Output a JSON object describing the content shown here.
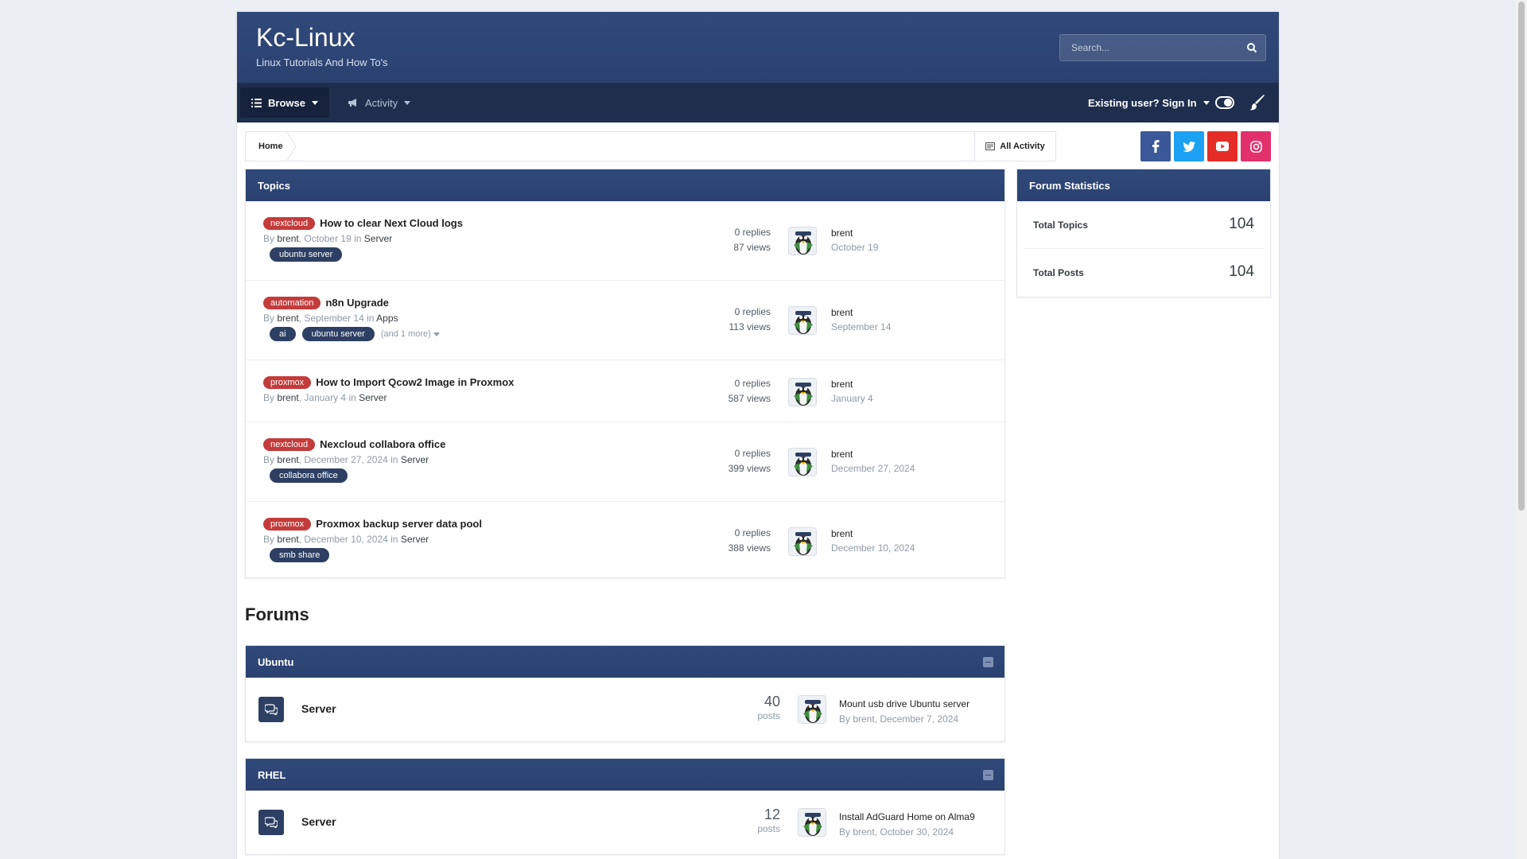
{
  "site": {
    "title": "Kc-Linux",
    "tagline": "Linux Tutorials And How To's",
    "search_placeholder": "Search..."
  },
  "nav": {
    "browse": "Browse",
    "activity": "Activity",
    "signin": "Existing user? Sign In"
  },
  "breadcrumb": {
    "home": "Home",
    "all_activity": "All Activity"
  },
  "social": [
    "facebook-icon",
    "twitter-icon",
    "youtube-icon",
    "instagram-icon"
  ],
  "topics": {
    "heading": "Topics",
    "items": [
      {
        "prefix": "nextcloud",
        "title": "How to clear Next Cloud logs",
        "by": "By",
        "author": "brent",
        "date": "October 19",
        "in": "in",
        "forum": "Server",
        "tags": [
          "ubuntu server"
        ],
        "more": "",
        "replies": "0 replies",
        "views": "87 views",
        "last_user": "brent",
        "last_date": "October 19"
      },
      {
        "prefix": "automation",
        "title": "n8n Upgrade",
        "by": "By",
        "author": "brent",
        "date": "September 14",
        "in": "in",
        "forum": "Apps",
        "tags": [
          "ai",
          "ubuntu server"
        ],
        "more": "(and 1 more)",
        "replies": "0 replies",
        "views": "113 views",
        "last_user": "brent",
        "last_date": "September 14"
      },
      {
        "prefix": "proxmox",
        "title": "How to Import Qcow2 Image in Proxmox",
        "by": "By",
        "author": "brent",
        "date": "January 4",
        "in": "in",
        "forum": "Server",
        "tags": [],
        "more": "",
        "replies": "0 replies",
        "views": "587 views",
        "last_user": "brent",
        "last_date": "January 4"
      },
      {
        "prefix": "nextcloud",
        "title": "Nexcloud collabora office",
        "by": "By",
        "author": "brent",
        "date": "December 27, 2024",
        "in": "in",
        "forum": "Server",
        "tags": [
          "collabora office"
        ],
        "more": "",
        "replies": "0 replies",
        "views": "399 views",
        "last_user": "brent",
        "last_date": "December 27, 2024"
      },
      {
        "prefix": "proxmox",
        "title": "Proxmox backup server data pool",
        "by": "By",
        "author": "brent",
        "date": "December 10, 2024",
        "in": "in",
        "forum": "Server",
        "tags": [
          "smb share"
        ],
        "more": "",
        "replies": "0 replies",
        "views": "388 views",
        "last_user": "brent",
        "last_date": "December 10, 2024"
      }
    ]
  },
  "forums": {
    "heading": "Forums",
    "categories": [
      {
        "name": "Ubuntu",
        "forum": "Server",
        "count": "40",
        "count_label": "posts",
        "last_title": "Mount usb drive Ubuntu server",
        "last_by": "By brent, December 7, 2024"
      },
      {
        "name": "RHEL",
        "forum": "Server",
        "count": "12",
        "count_label": "posts",
        "last_title": "Install AdGuard Home on Alma9",
        "last_by": "By brent, October 30, 2024"
      }
    ]
  },
  "stats": {
    "heading": "Forum Statistics",
    "total_topics_label": "Total Topics",
    "total_topics": "104",
    "total_posts_label": "Total Posts",
    "total_posts": "104"
  },
  "colors": {
    "header": "#30497a",
    "navbar": "#1f2e4c",
    "prefix": "#c33b3b",
    "tag": "#2d3f63"
  }
}
